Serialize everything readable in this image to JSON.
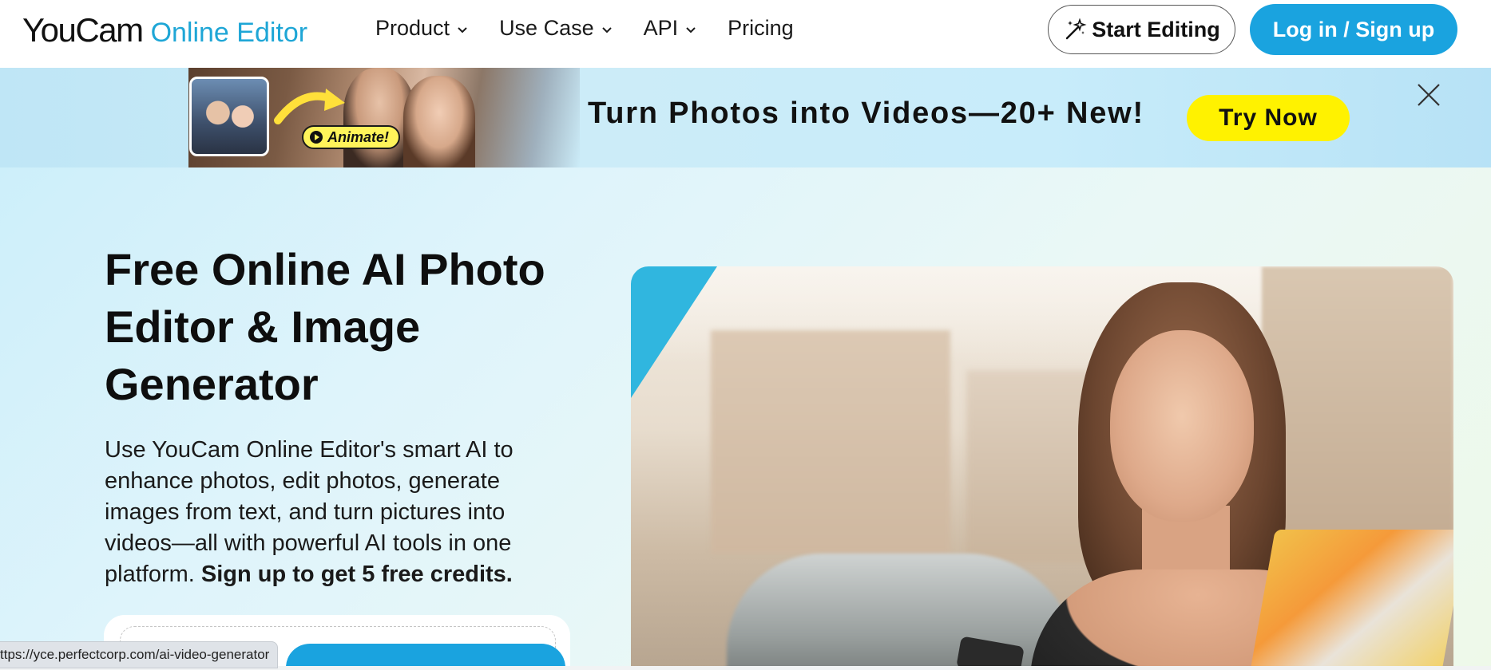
{
  "header": {
    "logo_main": "YouCam",
    "logo_sub": "Online Editor",
    "nav": [
      {
        "label": "Product",
        "has_dropdown": true
      },
      {
        "label": "Use Case",
        "has_dropdown": true
      },
      {
        "label": "API",
        "has_dropdown": true
      },
      {
        "label": "Pricing",
        "has_dropdown": false
      }
    ],
    "start_editing_label": "Start Editing",
    "login_label": "Log in / Sign up"
  },
  "banner": {
    "animate_label": "Animate!",
    "headline": "Turn Photos into Videos—20+ New!",
    "cta_label": "Try Now",
    "close_icon": "close-icon"
  },
  "hero": {
    "title": "Free Online AI Photo Editor & Image Generator",
    "description": "Use YouCam Online Editor's smart AI to enhance photos, edit photos, generate images from text, and turn pictures into videos—all with powerful AI tools in one platform.",
    "description_bold": "Sign up to get 5 free credits."
  },
  "status_bar": {
    "url": "ttps://yce.perfectcorp.com/ai-video-generator"
  },
  "colors": {
    "brand_blue": "#1aa3df",
    "accent_yellow": "#fff200",
    "triangle_blue": "#30b6df"
  }
}
